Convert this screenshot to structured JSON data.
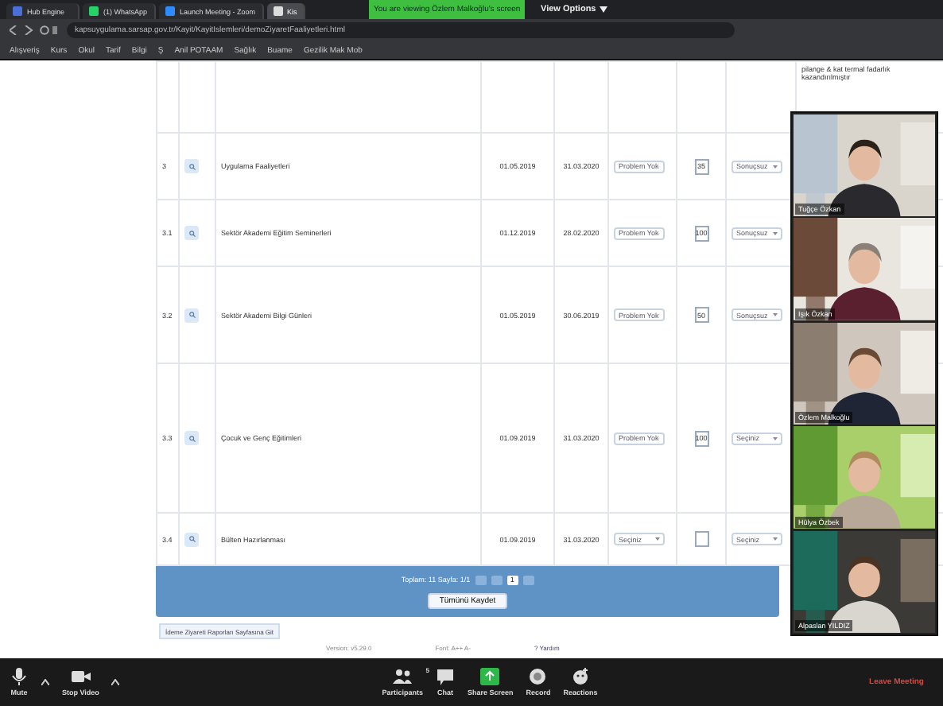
{
  "zoom_banner": {
    "text": "You are viewing Özlem Malkoğlu's screen",
    "view_options": "View Options"
  },
  "browser": {
    "tabs": [
      {
        "label": "Hub Engine",
        "kind": "grid",
        "selected": false
      },
      {
        "label": "(1) WhatsApp",
        "kind": "whatsapp",
        "selected": false
      },
      {
        "label": "Launch Meeting - Zoom",
        "kind": "zoom",
        "selected": false
      },
      {
        "label": "Kis",
        "kind": "page",
        "selected": true
      }
    ],
    "url": "kapsuygulama.sarsap.gov.tr/Kayit/KayitIslemleri/demoZiyaretFaaliyetleri.html",
    "bookmarks": [
      "Alışveriş",
      "Kurs",
      "Okul",
      "Tarif",
      "Bilgi",
      "Ş",
      "Anil POTAAM",
      "Sağlık",
      "Buame",
      "Gezilik Mak Mob"
    ]
  },
  "side_note": "pilange & kat termal fadarlık kazandırılmıştır",
  "table": {
    "rows": [
      {
        "no": "3",
        "name": "Uygulama Faaliyetleri",
        "start": "01.05.2019",
        "end": "31.03.2020",
        "status": "Problem Yok",
        "percent": "35",
        "result": "Sonuçsuz"
      },
      {
        "no": "3.1",
        "name": "Sektör Akademi Eğitim Seminerleri",
        "start": "01.12.2019",
        "end": "28.02.2020",
        "status": "Problem Yok",
        "percent": "100",
        "result": "Sonuçsuz"
      },
      {
        "no": "3.2",
        "name": "Sektör Akademi Bilgi Günleri",
        "start": "01.05.2019",
        "end": "30.06.2019",
        "status": "Problem Yok",
        "percent": "50",
        "result": "Sonuçsuz"
      },
      {
        "no": "3.3",
        "name": "Çocuk ve Genç Eğitimleri",
        "start": "01.09.2019",
        "end": "31.03.2020",
        "status": "Problem Yok",
        "percent": "100",
        "result": "Seçiniz"
      },
      {
        "no": "3.4",
        "name": "Bülten Hazırlanması",
        "start": "01.09.2019",
        "end": "31.03.2020",
        "status": "Seçiniz",
        "result": "Seçiniz"
      }
    ]
  },
  "pagination": {
    "summary": "Toplam: 11 Sayfa: 1/1",
    "pages": [
      {
        "label": "1",
        "selected": true
      }
    ]
  },
  "save_button": "Tümünü Kaydet",
  "report_button": "İdeme Ziyareti Raporları Sayfasına Git",
  "footer": {
    "version": "Version: v5.29.0",
    "font": "Font: A++ A-",
    "help": "? Yardım"
  },
  "participants": [
    {
      "name": "Tuğçe Özkan"
    },
    {
      "name": "Işık Özkan"
    },
    {
      "name": "Özlem Malkoğlu"
    },
    {
      "name": "Hülya Özbek"
    },
    {
      "name": "Alpaslan YILDIZ"
    }
  ],
  "toolbar": {
    "items": [
      {
        "label": "Mute",
        "kind": "mic"
      },
      {
        "label": "Stop Video",
        "kind": "video"
      },
      {
        "label": "Participants",
        "kind": "participants",
        "count": "5"
      },
      {
        "label": "Chat",
        "kind": "chat"
      },
      {
        "label": "Share Screen",
        "kind": "share"
      },
      {
        "label": "Record",
        "kind": "record"
      },
      {
        "label": "Reactions",
        "kind": "reactions"
      }
    ],
    "leave": "Leave Meeting"
  }
}
